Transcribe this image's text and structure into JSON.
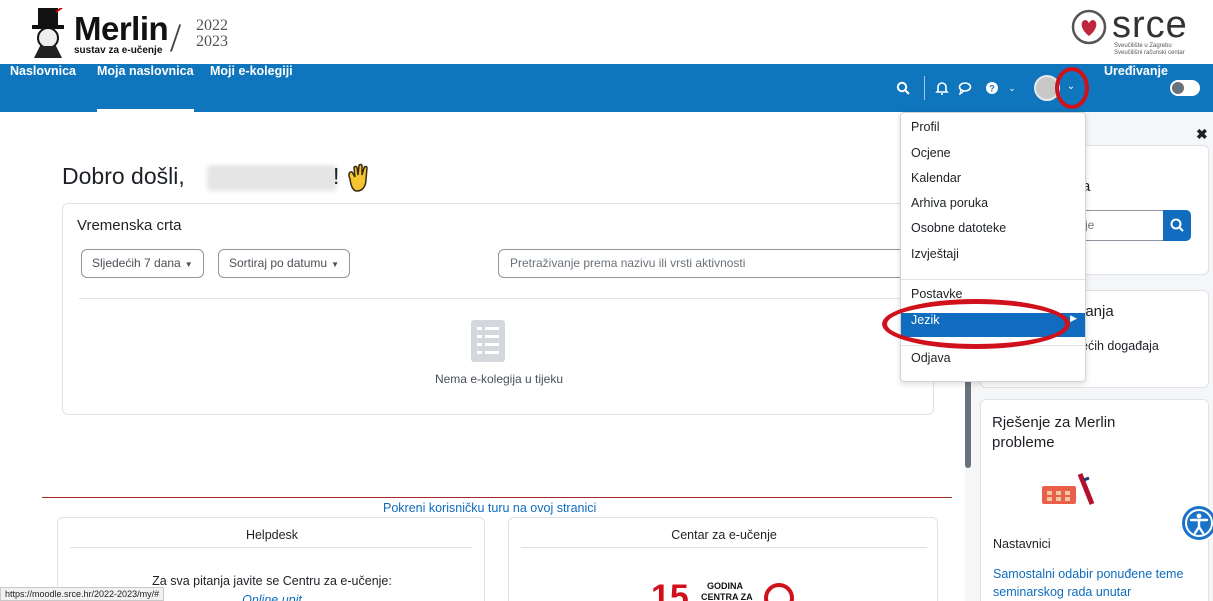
{
  "banner": {
    "logo_word": "Merlin",
    "logo_sub": "sustav za e-učenje",
    "logo_year_top": "2022",
    "logo_year_bottom": "2023",
    "partner_word": "srce",
    "partner_sub_1": "Sveučilište u Zagrebu",
    "partner_sub_2": "Sveučilišni računski centar"
  },
  "nav": {
    "links": [
      "Naslovnica",
      "Moja naslovnica",
      "Moji e-kolegiji"
    ],
    "active_index": 1,
    "edit_label": "Uređivanje",
    "edit_toggle": "off"
  },
  "main": {
    "welcome": "Dobro došli,",
    "welcome_end": "!",
    "timeline": {
      "title": "Vremenska crta",
      "filter_range": "Sljedećih 7 dana",
      "sort": "Sortiraj po datumu",
      "search_placeholder": "Pretraživanje prema nazivu ili vrsti aktivnosti",
      "empty_text": "Nema e-kolegija u tijeku"
    },
    "tour_link": "Pokreni korisničku turu na ovoj stranici",
    "helpdesk": {
      "title": "Helpdesk",
      "text": "Za sva pitanja javite se Centru za e-učenje:",
      "link": "Online upit"
    },
    "centar": {
      "title": "Centar za e-učenje",
      "logo_number": "15",
      "logo_line_1": "GODINA",
      "logo_line_2": "CENTRA ZA"
    }
  },
  "user_menu": {
    "items": [
      "Profil",
      "Ocjene",
      "Kalendar",
      "Arhiva poruka",
      "Osobne datoteke",
      "Izvještaji"
    ],
    "settings": "Postavke",
    "language": "Jezik",
    "logout": "Odjava",
    "highlighted": "Jezik"
  },
  "drawer": {
    "block1_title_fragment": "gija",
    "block1_search_fragment": "egije",
    "block2_title_fragment": "đanja",
    "block2_text_fragment": "ećih događaja",
    "block2_text_fragment_2": ".",
    "block3_title": "Rješenje za Merlin probleme",
    "block3_role": "Nastavnici",
    "block3_link": "Samostalni odabir ponuđene teme seminarskog rada unutar"
  },
  "status_bar": {
    "url": "https://moodle.srce.hr/2022-2023/my/#"
  },
  "colors": {
    "nav_bg": "#0f75bc",
    "link": "#0f6cbf",
    "annotation_red": "#d0101a"
  }
}
